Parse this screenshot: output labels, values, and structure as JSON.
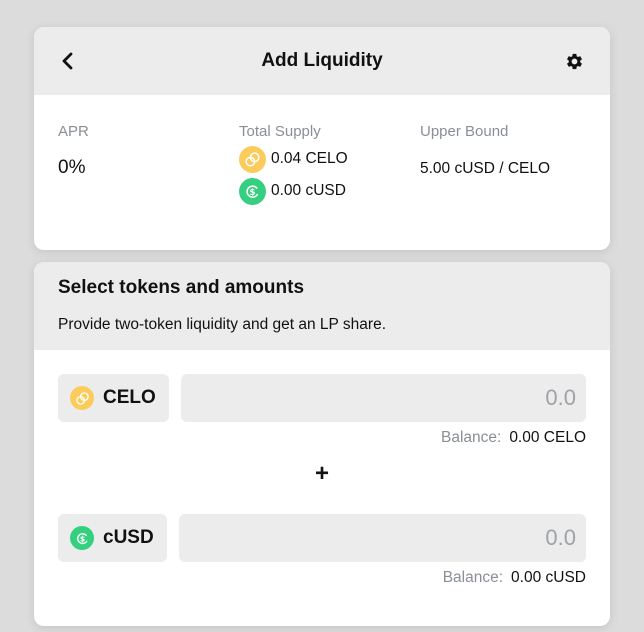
{
  "header": {
    "title": "Add Liquidity",
    "back_icon": "chevron-left-icon",
    "settings_icon": "gear-icon"
  },
  "stats": {
    "apr": {
      "label": "APR",
      "value": "0%"
    },
    "total_supply": {
      "label": "Total Supply",
      "items": [
        {
          "token": "CELO",
          "icon": "celo-coin-icon",
          "value": "0.04 CELO"
        },
        {
          "token": "cUSD",
          "icon": "cusd-coin-icon",
          "value": "0.00 cUSD"
        }
      ]
    },
    "upper_bound": {
      "label": "Upper Bound",
      "value": "5.00 cUSD / CELO"
    }
  },
  "select": {
    "title": "Select tokens and amounts",
    "subtitle": "Provide two-token liquidity and get an LP share.",
    "separator": "+",
    "tokens": [
      {
        "symbol": "CELO",
        "icon": "celo-coin-icon",
        "amount_placeholder": "0.0",
        "amount_value": "",
        "balance_label": "Balance:",
        "balance_value": "0.00 CELO"
      },
      {
        "symbol": "cUSD",
        "icon": "cusd-coin-icon",
        "amount_placeholder": "0.0",
        "amount_value": "",
        "balance_label": "Balance:",
        "balance_value": "0.00 cUSD"
      }
    ]
  },
  "colors": {
    "background": "#dcdcdc",
    "panel_header": "#ececed",
    "celo_gold": "#fbcc5c",
    "cusd_green": "#35d07f",
    "muted_text": "#8a8f95"
  }
}
